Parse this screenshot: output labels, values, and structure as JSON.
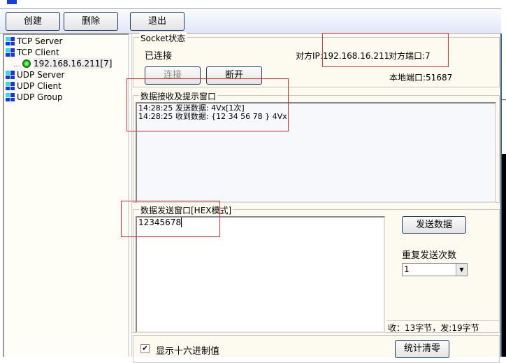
{
  "toolbar": {
    "create": "创建",
    "delete": "删除",
    "exit": "退出"
  },
  "tree": {
    "items": [
      {
        "label": "TCP Server"
      },
      {
        "label": "TCP Client"
      },
      {
        "label": "192.168.16.211[7]"
      },
      {
        "label": "UDP Server"
      },
      {
        "label": "UDP Client"
      },
      {
        "label": "UDP Group"
      }
    ]
  },
  "socket": {
    "group_label": "Socket状态",
    "status": "已连接",
    "remote_ip": "对方IP:192.168.16.211",
    "remote_port": "对方端口:7",
    "local_port": "本地端口:51687",
    "connect": "连接",
    "disconnect": "断开"
  },
  "receive": {
    "group_label": "数据接收及提示窗口",
    "lines": [
      "14:28:25 发送数据:  4Vx[1次]",
      "14:28:25 收到数据: {12 34 56 78 } 4Vx"
    ]
  },
  "send": {
    "group_label": "数据发送窗口[HEX模式]",
    "value": "12345678",
    "send_button": "发送数据",
    "repeat_label": "重复发送次数",
    "repeat_value": "1",
    "stats": "收：13字节，发:19字节"
  },
  "bottom": {
    "show_hex": "显示十六进制值",
    "show_hex_checked": true,
    "clear_stats": "统计清零"
  },
  "colors": {
    "annotation": "#e53333",
    "accent": "#1f3c63"
  }
}
